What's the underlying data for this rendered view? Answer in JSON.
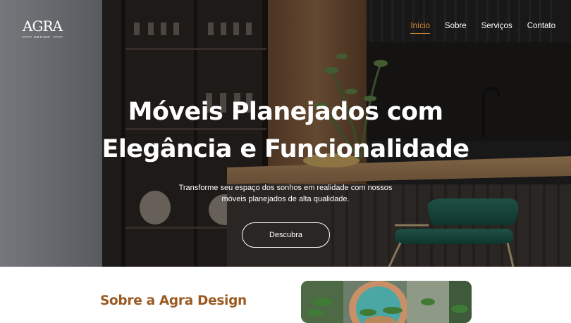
{
  "header": {
    "logo": {
      "main": "AGRA",
      "sub": "DESIGN"
    },
    "nav": [
      {
        "label": "Início",
        "active": true
      },
      {
        "label": "Sobre",
        "active": false
      },
      {
        "label": "Serviços",
        "active": false
      },
      {
        "label": "Contato",
        "active": false
      }
    ]
  },
  "hero": {
    "title_line1": "Móveis Planejados com",
    "title_line2": "Elegância e Funcionalidade",
    "subtitle_line1": "Transforme seu espaço dos sonhos em realidade com nossos",
    "subtitle_line2": "móveis planejados de alta qualidade.",
    "cta_label": "Descubra"
  },
  "about": {
    "title": "Sobre a Agra Design"
  },
  "colors": {
    "accent": "#d88a3a",
    "heading_brown": "#9b5a22",
    "chair_green": "#1f5a4d"
  }
}
